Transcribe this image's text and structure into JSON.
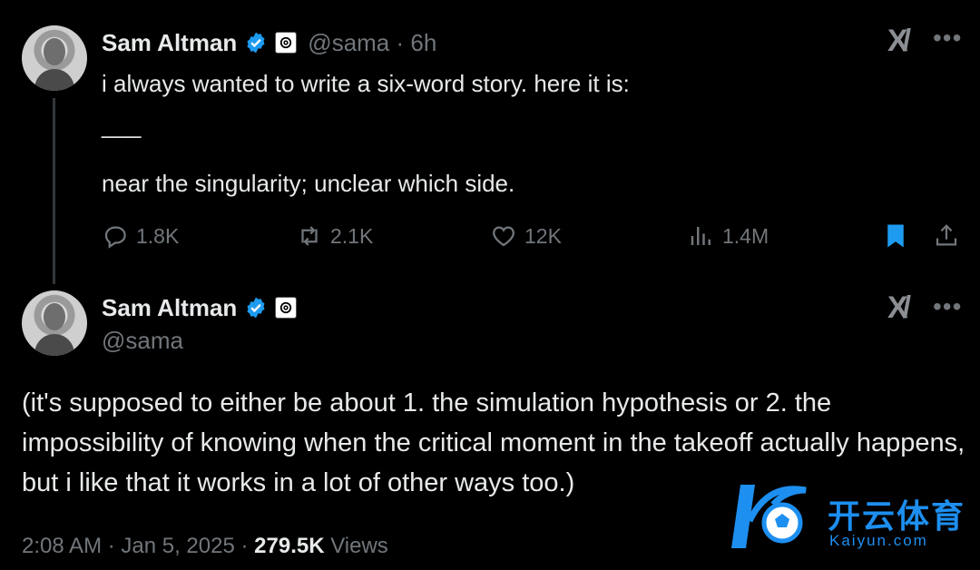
{
  "tweet1": {
    "author_name": "Sam Altman",
    "handle_time": "@sama · 6h",
    "line1": "i always wanted to write a six-word story. here it is:",
    "separator": "___",
    "line2": "near the singularity; unclear which side.",
    "replies": "1.8K",
    "reposts": "2.1K",
    "likes": "12K",
    "views": "1.4M"
  },
  "tweet2": {
    "author_name": "Sam Altman",
    "handle": "@sama",
    "body": "(it's supposed to either be about 1. the simulation hypothesis or 2. the impossibility of knowing when the critical moment in the takeoff actually happens, but i like that it works in a lot of other ways too.)",
    "timestamp": "2:08 AM · Jan 5, 2025 · ",
    "view_count": "279.5K",
    "views_label": " Views"
  },
  "icons": {
    "verified": "verified-badge-icon",
    "affiliate": "openai-logo-icon",
    "grok": "grok-icon",
    "more": "more-dots-icon",
    "reply": "reply-icon",
    "repost": "repost-icon",
    "like": "heart-icon",
    "views": "analytics-icon",
    "bookmark": "bookmark-icon",
    "share": "share-icon"
  },
  "colors": {
    "accent": "#1d9bf0",
    "text": "#e7e9ea",
    "secondary": "#71767b",
    "background": "#000000"
  },
  "watermark": {
    "cn_text": "开云体育",
    "en_text": "Kaiyun.com"
  }
}
